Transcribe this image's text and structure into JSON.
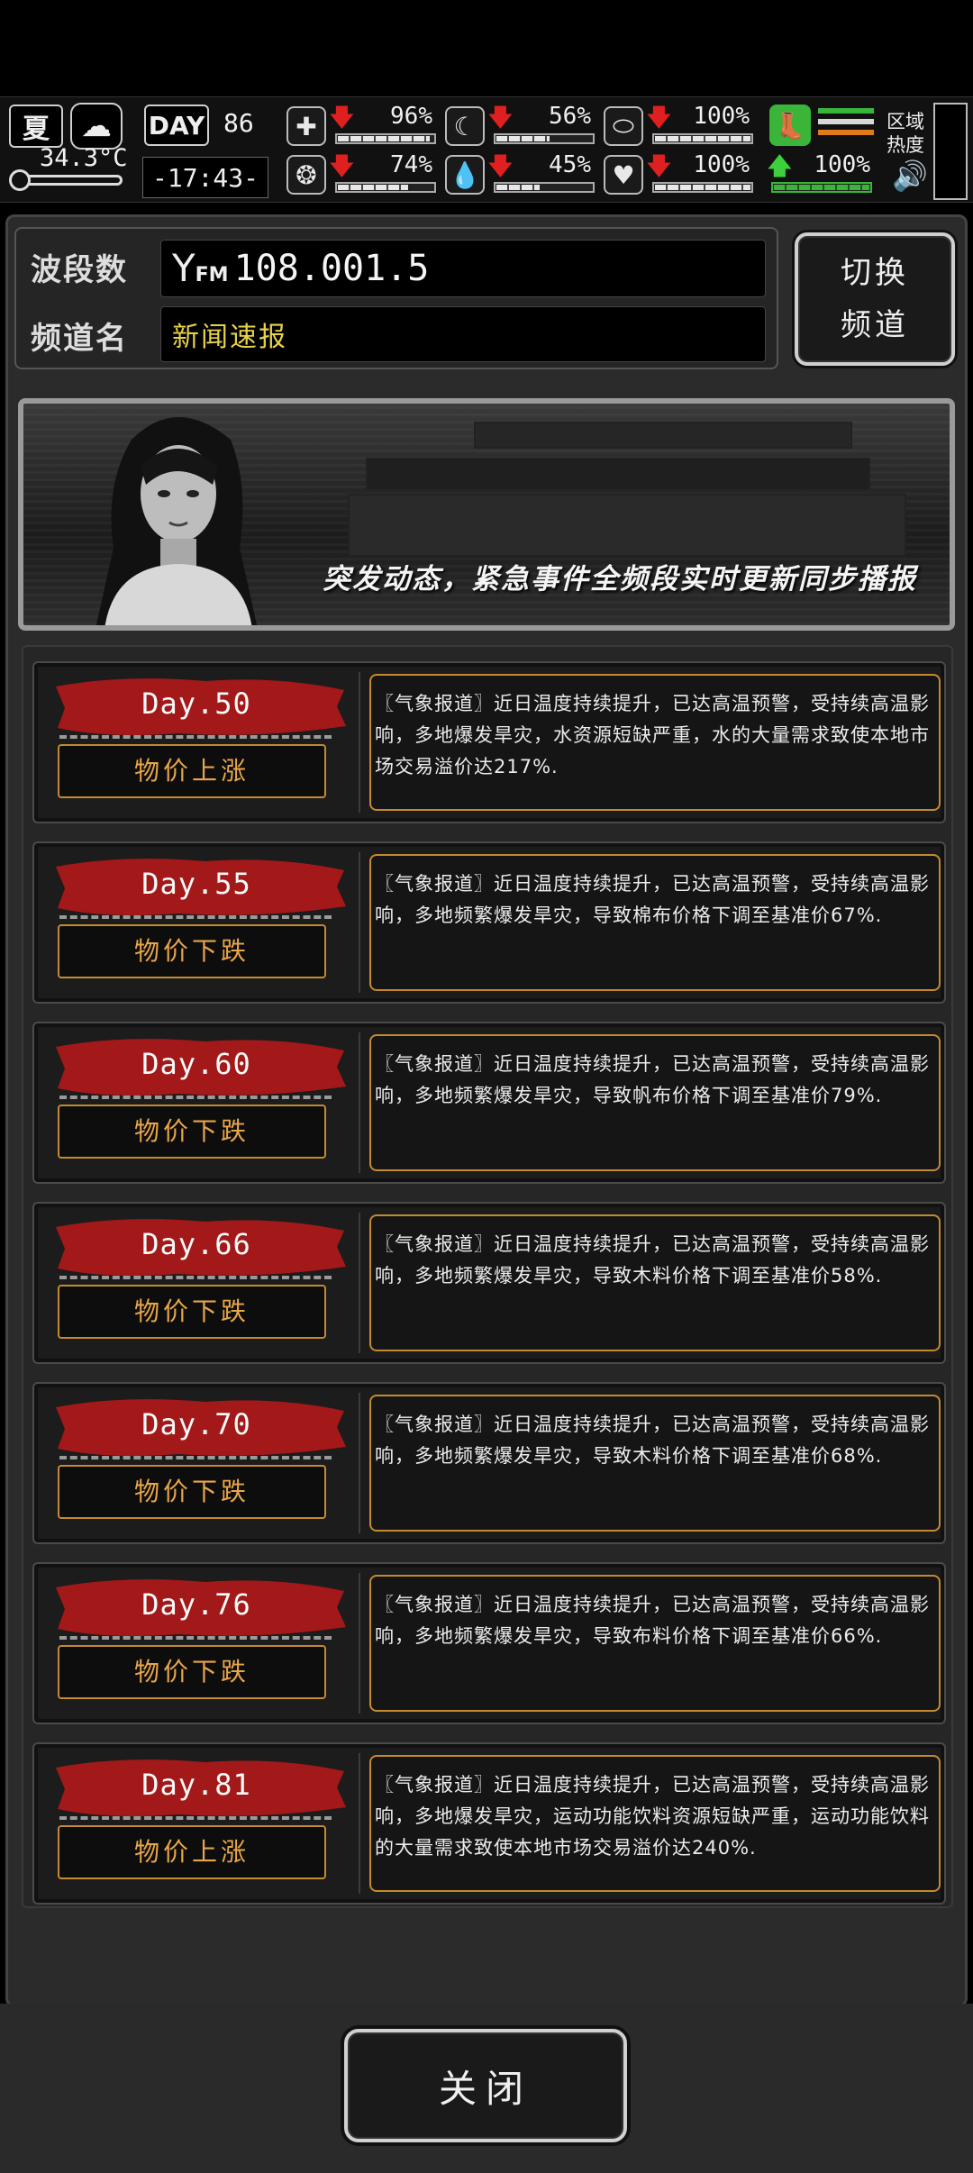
{
  "status": {
    "season": "夏",
    "temperature": "34.3°C",
    "day_label": "DAY",
    "day_value": "86",
    "clock": "-17:43-",
    "region_label_line1": "区域",
    "region_label_line2": "热度",
    "stats": [
      {
        "name": "medical",
        "icon": "medkit-icon",
        "arrow": "down",
        "value": "96%",
        "level": 0.96
      },
      {
        "name": "stomach",
        "icon": "stomach-icon",
        "arrow": "down",
        "value": "56%",
        "level": 0.56
      },
      {
        "name": "pill",
        "icon": "pill-icon",
        "arrow": "down",
        "value": "100%",
        "level": 1.0
      },
      {
        "name": "brain",
        "icon": "brain-icon",
        "arrow": "down",
        "value": "74%",
        "level": 0.74
      },
      {
        "name": "water",
        "icon": "water-drop-icon",
        "arrow": "down",
        "value": "45%",
        "level": 0.45
      },
      {
        "name": "heart",
        "icon": "heart-icon",
        "arrow": "down",
        "value": "100%",
        "level": 1.0
      }
    ],
    "stamina": {
      "icon": "boot-icon",
      "arrow": "up",
      "value": "100%",
      "level": 1.0
    },
    "colors": {
      "down_arrow": "#e02020",
      "up_arrow": "#3cd03c",
      "stamina_green": "#3ab53a"
    }
  },
  "radio": {
    "band_label": "波段数",
    "band_value": "108.001.5",
    "fm_prefix": "FM",
    "channel_label": "频道名",
    "channel_value": "新闻速报",
    "switch_line1": "切换",
    "switch_line2": "频道"
  },
  "banner": {
    "caption": "突发动态，紧急事件全频段实时更新同步播报"
  },
  "news": [
    {
      "day": "Day.50",
      "tag": "物价上涨",
      "text": "〖气象报道〗近日温度持续提升，已达高温预警，受持续高温影响，多地爆发旱灾，水资源短缺严重，水的大量需求致使本地市场交易溢价达217%."
    },
    {
      "day": "Day.55",
      "tag": "物价下跌",
      "text": "〖气象报道〗近日温度持续提升，已达高温预警，受持续高温影响，多地频繁爆发旱灾，导致棉布价格下调至基准价67%."
    },
    {
      "day": "Day.60",
      "tag": "物价下跌",
      "text": "〖气象报道〗近日温度持续提升，已达高温预警，受持续高温影响，多地频繁爆发旱灾，导致帆布价格下调至基准价79%."
    },
    {
      "day": "Day.66",
      "tag": "物价下跌",
      "text": "〖气象报道〗近日温度持续提升，已达高温预警，受持续高温影响，多地频繁爆发旱灾，导致木料价格下调至基准价58%."
    },
    {
      "day": "Day.70",
      "tag": "物价下跌",
      "text": "〖气象报道〗近日温度持续提升，已达高温预警，受持续高温影响，多地频繁爆发旱灾，导致木料价格下调至基准价68%."
    },
    {
      "day": "Day.76",
      "tag": "物价下跌",
      "text": "〖气象报道〗近日温度持续提升，已达高温预警，受持续高温影响，多地频繁爆发旱灾，导致布料价格下调至基准价66%."
    },
    {
      "day": "Day.81",
      "tag": "物价上涨",
      "text": "〖气象报道〗近日温度持续提升，已达高温预警，受持续高温影响，多地爆发旱灾，运动功能饮料资源短缺严重，运动功能饮料的大量需求致使本地市场交易溢价达240%."
    }
  ],
  "close_label": "关闭"
}
